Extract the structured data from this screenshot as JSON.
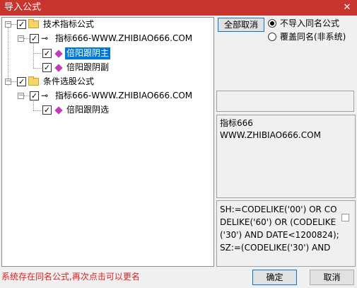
{
  "window": {
    "title": "导入公式",
    "close_glyph": "✕"
  },
  "tree": {
    "nodes": [
      {
        "label": "技术指标公式",
        "expander": "−",
        "check": "✓"
      },
      {
        "label": "指标666-WWW.ZHIBIAO666.COM",
        "expander": "−",
        "check": "✓"
      },
      {
        "label": "倍阳跟阴主",
        "check": "✓"
      },
      {
        "label": "倍阳跟阴副",
        "check": "✓"
      },
      {
        "label": "条件选股公式",
        "expander": "−",
        "check": "✓"
      },
      {
        "label": "指标666-WWW.ZHIBIAO666.COM",
        "expander": "−",
        "check": "✓"
      },
      {
        "label": "倍阳跟阴选",
        "check": "✓"
      }
    ]
  },
  "options": {
    "cancel_all_label": "全部取消",
    "radio_skip_label": "不导入同名公式",
    "radio_overwrite_label": "覆盖同名(非系统)",
    "selected": "radio_skip"
  },
  "info": {
    "name_line1": "指标666",
    "name_line2": "WWW.ZHIBIAO666.COM",
    "code": "SH:=CODELIKE('00') OR CODELIKE('60') OR (CODELIKE('30') AND DATE<1200824);\nSZ:=(CODELIKE('30') AND"
  },
  "footer": {
    "status_text": "系统存在同名公式,再次点击可以更名",
    "ok_label": "确定",
    "cancel_label": "取消"
  },
  "colors": {
    "titlebar": "#c8342e",
    "selection": "#0078d7",
    "status": "#e02020"
  }
}
